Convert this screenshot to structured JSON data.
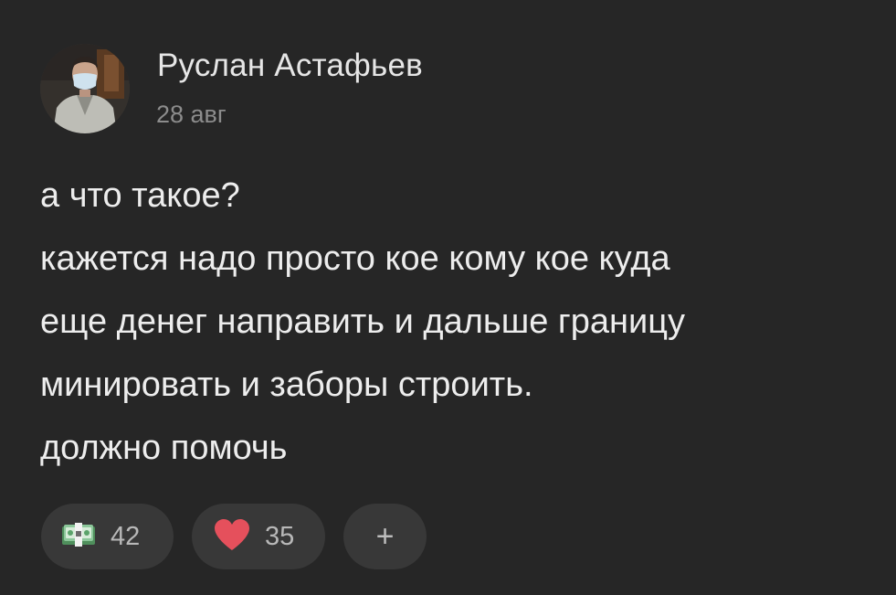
{
  "post": {
    "author_name": "Руслан Астафьев",
    "date": "28 авг",
    "message_lines": [
      "а что такое?",
      "кажется надо просто кое кому кое куда",
      "еще денег направить и дальше границу",
      "минировать и заборы строить.",
      "должно помочь"
    ]
  },
  "reactions": [
    {
      "icon": "money-icon",
      "count": "42"
    },
    {
      "icon": "heart-icon",
      "count": "35"
    }
  ],
  "add_reaction": {
    "label": "+"
  },
  "colors": {
    "background": "#262626",
    "pill": "#383838",
    "heart": "#e5505c",
    "money": "#5aa36a"
  }
}
